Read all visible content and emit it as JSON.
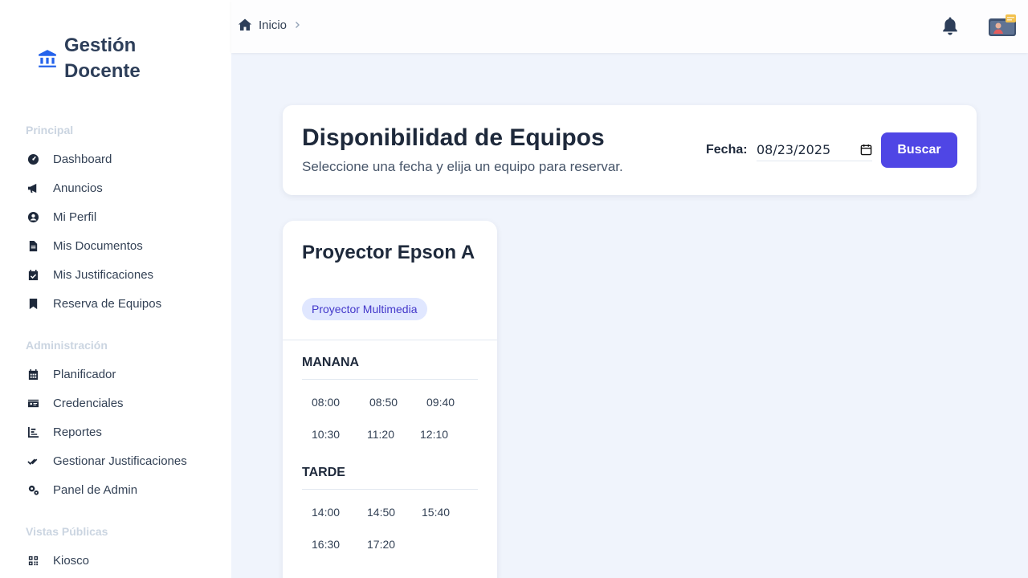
{
  "brand": {
    "title": "Gestión Docente"
  },
  "sidebar": {
    "sections": [
      {
        "label": "Principal"
      },
      {
        "label": "Administración"
      },
      {
        "label": "Vistas Públicas"
      }
    ],
    "items": [
      {
        "label": "Dashboard",
        "icon": "gauge-icon"
      },
      {
        "label": "Anuncios",
        "icon": "megaphone-icon"
      },
      {
        "label": "Mi Perfil",
        "icon": "user-circle-icon"
      },
      {
        "label": "Mis Documentos",
        "icon": "file-icon"
      },
      {
        "label": "Mis Justificaciones",
        "icon": "calendar-check-icon"
      },
      {
        "label": "Reserva de Equipos",
        "icon": "bookmark-icon"
      },
      {
        "label": "Planificador",
        "icon": "calendar-icon"
      },
      {
        "label": "Credenciales",
        "icon": "id-card-icon"
      },
      {
        "label": "Reportes",
        "icon": "chart-bar-icon"
      },
      {
        "label": "Gestionar Justificaciones",
        "icon": "check-double-icon"
      },
      {
        "label": "Panel de Admin",
        "icon": "cogs-icon"
      },
      {
        "label": "Kiosco",
        "icon": "qr-grid-icon"
      }
    ]
  },
  "header": {
    "breadcrumb": "Inicio"
  },
  "main": {
    "title": "Disponibilidad de Equipos",
    "subtitle": "Seleccione una fecha y elija un equipo para reservar.",
    "date_label": "Fecha:",
    "date_value": "08/23/2025",
    "search_label": "Buscar"
  },
  "equipment": {
    "name": "Proyector Epson A",
    "type": "Proyector Multimedia",
    "shifts": [
      {
        "label": "MANANA",
        "slots": [
          "08:00",
          "08:50",
          "09:40",
          "10:30",
          "11:20",
          "12:10"
        ]
      },
      {
        "label": "TARDE",
        "slots": [
          "14:00",
          "14:50",
          "15:40",
          "16:30",
          "17:20"
        ]
      }
    ]
  },
  "colors": {
    "accent": "#4f46e5",
    "badge_bg": "#e0e7ff",
    "badge_text": "#4338ca",
    "brand_icon": "#2563eb"
  }
}
